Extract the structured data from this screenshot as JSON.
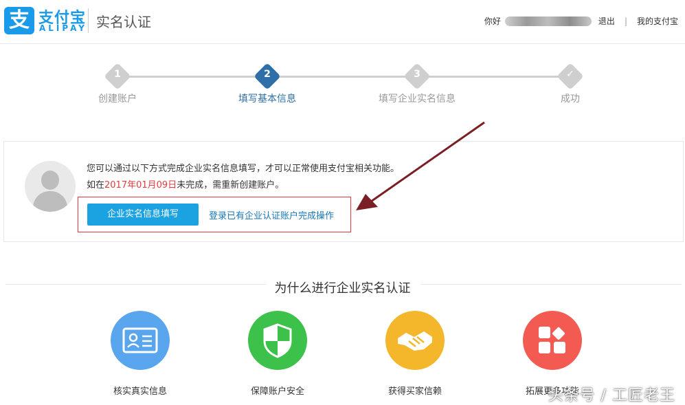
{
  "header": {
    "logo_glyph": "支",
    "logo_cn": "支付宝",
    "logo_en": "ALIPAY",
    "page_title": "实名认证",
    "greeting": "你好",
    "logout": "退出",
    "separator": "|",
    "my_alipay": "我的支付宝"
  },
  "steps": [
    {
      "num": "1",
      "label": "创建账户",
      "state": "done"
    },
    {
      "num": "2",
      "label": "填写基本信息",
      "state": "active"
    },
    {
      "num": "3",
      "label": "填写企业实名信息",
      "state": "todo"
    },
    {
      "num": "✓",
      "label": "成功",
      "state": "todo"
    }
  ],
  "notice": {
    "line1": "您可以通过以下方式完成企业实名信息填写，才可以正常使用支付宝相关功能。",
    "line2_prefix": "如在",
    "line2_date": "2017年01月09日",
    "line2_suffix": "未完成，需重新创建账户。",
    "primary_button": "企业实名信息填写",
    "secondary_link": "登录已有企业认证账户完成操作"
  },
  "why": {
    "title": "为什么进行企业实名认证",
    "features": [
      {
        "label": "核实真实信息",
        "icon": "id-card-icon",
        "color": "#5aa6ee"
      },
      {
        "label": "保障账户安全",
        "icon": "shield-icon",
        "color": "#3cc14a"
      },
      {
        "label": "获得买家信赖",
        "icon": "handshake-icon",
        "color": "#f4b72c"
      },
      {
        "label": "拓展更多功能",
        "icon": "apps-icon",
        "color": "#f25a52"
      }
    ]
  },
  "watermark": "头条号 / 工匠老王",
  "colors": {
    "brand": "#1a9bea",
    "active_step": "#2f6fa7",
    "highlight": "#e3393c",
    "arrow": "#7a1f24"
  }
}
